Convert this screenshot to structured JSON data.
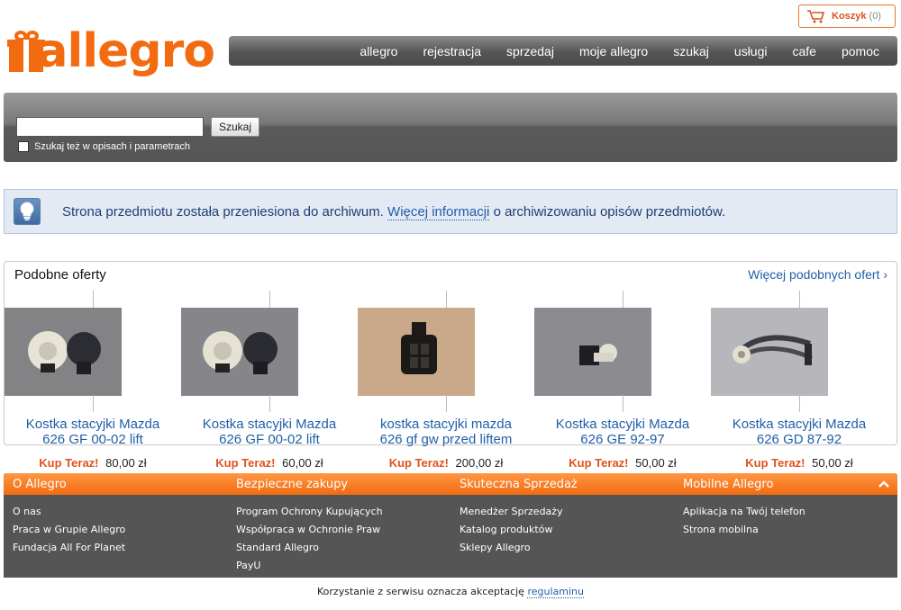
{
  "header": {
    "logo_text": "allegro",
    "cart": {
      "label": "Koszyk",
      "count": "(0)"
    },
    "nav": [
      "allegro",
      "rejestracja",
      "sprzedaj",
      "moje allegro",
      "szukaj",
      "usługi",
      "cafe",
      "pomoc"
    ]
  },
  "search": {
    "value": "",
    "button_label": "Szukaj",
    "checkbox_label": "Szukaj też w opisach i parametrach"
  },
  "info": {
    "text_before": "Strona przedmiotu została przeniesiona do archiwum.",
    "link_text": "Więcej informacji",
    "text_after": "o archiwizowaniu opisów przedmiotów."
  },
  "similar": {
    "title": "Podobne oferty",
    "more_link": "Więcej podobnych ofert ›",
    "buy_label": "Kup Teraz!",
    "offers": [
      {
        "title": "Kostka stacyjki Mazda 626 GF 00-02 lift",
        "price": "80,00 zł"
      },
      {
        "title": "Kostka stacyjki Mazda 626 GF 00-02 lift",
        "price": "60,00 zł"
      },
      {
        "title": "kostka stacyjki mazda 626 gf gw przed liftem",
        "price": "200,00 zł"
      },
      {
        "title": "Kostka stacyjki Mazda 626 GE 92-97",
        "price": "50,00 zł"
      },
      {
        "title": "Kostka stacyjki Mazda 626 GD 87-92",
        "price": "50,00 zł"
      }
    ]
  },
  "footer": {
    "columns": [
      {
        "heading": "O Allegro",
        "links": [
          "O nas",
          "Praca w Grupie Allegro",
          "Fundacja All For Planet"
        ]
      },
      {
        "heading": "Bezpieczne zakupy",
        "links": [
          "Program Ochrony Kupujących",
          "Współpraca w Ochronie Praw",
          "Standard Allegro",
          "PayU"
        ]
      },
      {
        "heading": "Skuteczna Sprzedaż",
        "links": [
          "Menedżer Sprzedaży",
          "Katalog produktów",
          "Sklepy Allegro"
        ]
      },
      {
        "heading": "Mobilne Allegro",
        "links": [
          "Aplikacja na Twój telefon",
          "Strona mobilna"
        ]
      }
    ],
    "terms_text": "Korzystanie z serwisu oznacza akceptację",
    "terms_link": "regulaminu"
  },
  "colors": {
    "brand_orange": "#f26b10",
    "link_blue": "#1f5fa8",
    "footer_gray": "#555555"
  },
  "icons": {
    "cart": "cart-icon",
    "info": "lightbulb-icon",
    "footer_toggle": "chevron-up-icon"
  }
}
